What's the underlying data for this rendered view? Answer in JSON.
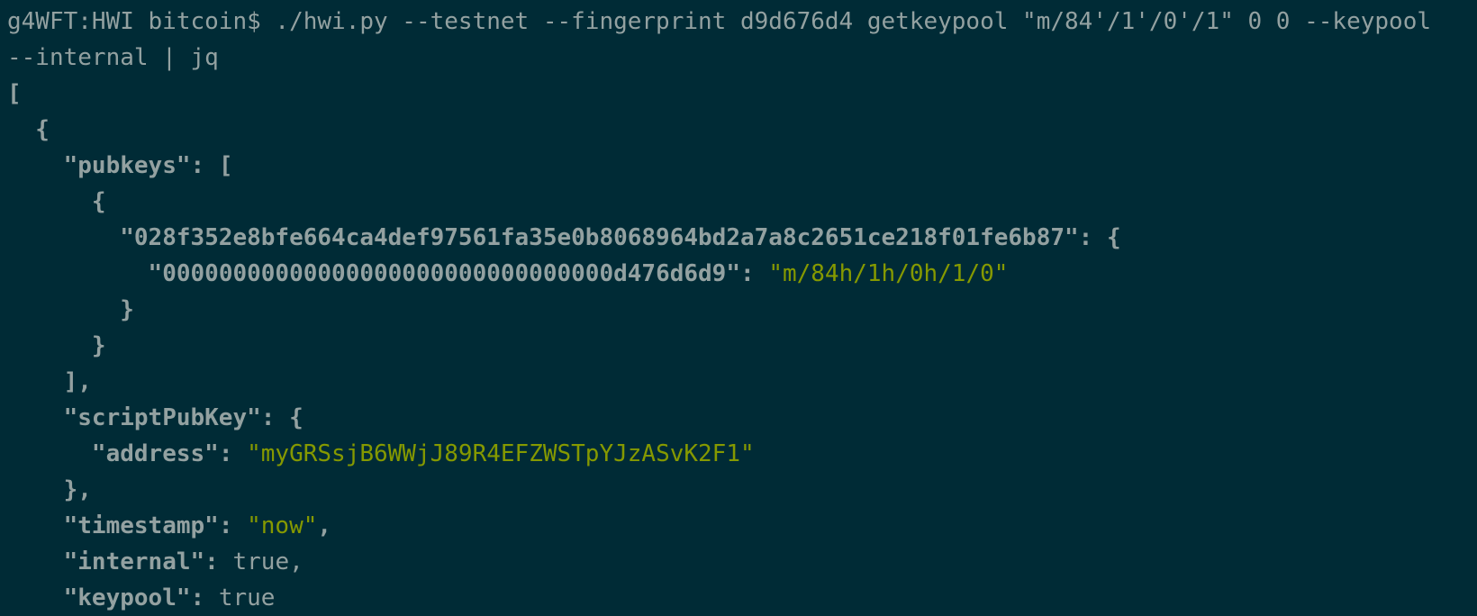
{
  "terminal": {
    "prompt": "g4WFT:HWI bitcoin$ ",
    "command_line1": "./hwi.py --testnet --fingerprint d9d676d4 getkeypool \"m/84'/1'/0'/1\" 0 0 --keypool",
    "command_line2": "--internal | jq"
  },
  "output": {
    "open_array": "[",
    "open_obj": "  {",
    "pubkeys_key": "\"pubkeys\"",
    "pubkeys_open": ": [",
    "inner_open": "{",
    "pubkey_hex": "\"028f352e8bfe664ca4def97561fa35e0b8068964bd2a7a8c2651ce218f01fe6b87\"",
    "pubkey_open": ": {",
    "fingerprint_key": "\"00000000000000000000000000000000d476d6d9\"",
    "colon": ": ",
    "derivation_path": "\"m/84h/1h/0h/1/0\"",
    "close_brace": "}",
    "close_array_comma": "],",
    "scriptpubkey_key": "\"scriptPubKey\"",
    "scriptpubkey_open": ": {",
    "address_key": "\"address\"",
    "address_value": "\"myGRSsjB6WWjJ89R4EFZWSTpYJzASvK2F1\"",
    "close_obj_comma": "},",
    "timestamp_key": "\"timestamp\"",
    "timestamp_value": "\"now\"",
    "comma": ",",
    "internal_key": "\"internal\"",
    "internal_value": "true,",
    "keypool_key": "\"keypool\"",
    "keypool_value": "true"
  },
  "colors": {
    "background": "#002b36",
    "text": "#93a1a1",
    "string": "#859900"
  }
}
